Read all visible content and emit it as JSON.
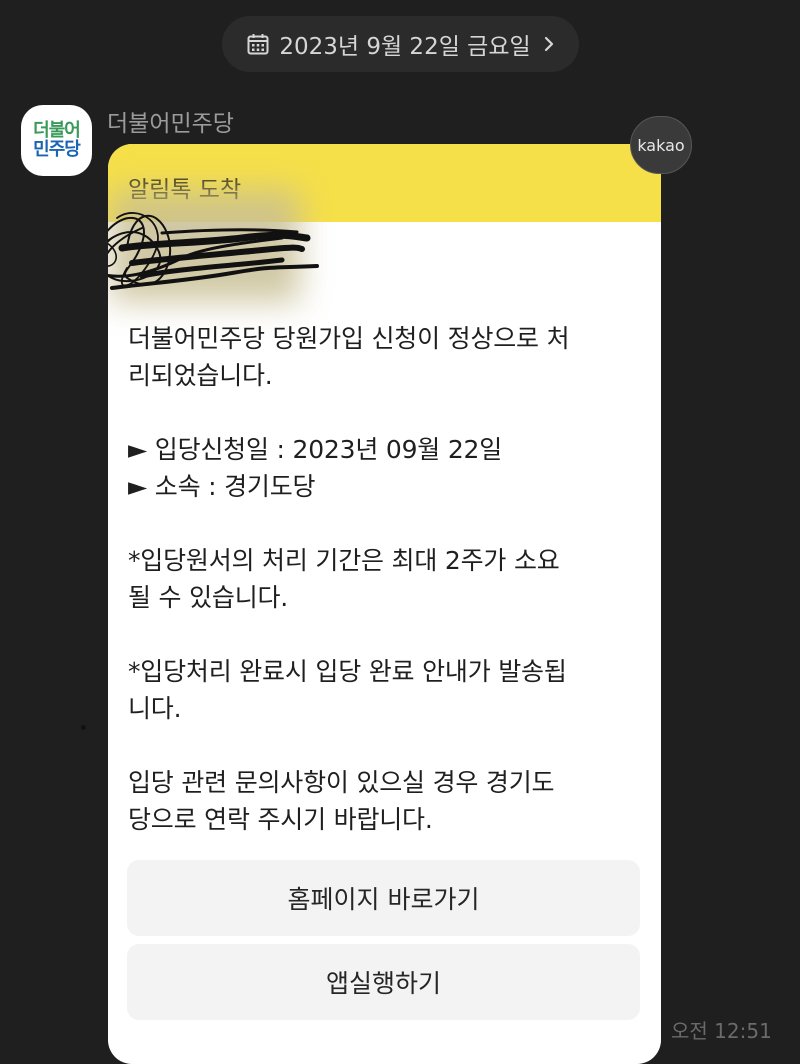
{
  "date_header": {
    "label": "2023년 9월 22일 금요일",
    "calendar_icon": "calendar-icon",
    "chevron_icon": "chevron-right-icon"
  },
  "sender": {
    "name": "더불어민주당",
    "avatar_line1": "더불어",
    "avatar_line2": "민주당",
    "avatar_colors": {
      "line1": "#3a9a5a",
      "line2": "#1b64b4"
    }
  },
  "kakao_badge": "kakao",
  "message": {
    "header": "알림톡 도착",
    "header_color": "#f6e049",
    "body_lines": [
      "더불어민주당 당원가입 신청이 정상으로 처",
      "리되었습니다.",
      "► 입당신청일 : 2023년 09월 22일",
      "► 소속 : 경기도당",
      "*입당원서의 처리 기간은 최대 2주가 소요",
      "될 수 있습니다.",
      "*입당처리 완료시 입당 완료 안내가 발송됩",
      "니다.",
      "입당 관련 문의사항이 있으실 경우 경기도",
      "당으로 연락 주시기 바랍니다."
    ]
  },
  "buttons": {
    "homepage": "홈페이지 바로가기",
    "app": "앱실행하기"
  },
  "timestamp": "오전 12:51"
}
